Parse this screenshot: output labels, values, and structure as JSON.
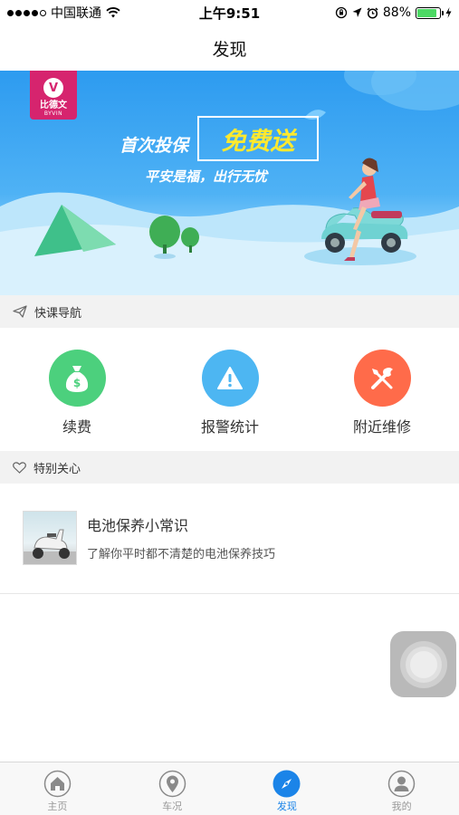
{
  "status_bar": {
    "carrier": "中国联通",
    "time": "上午9:51",
    "battery": "88%",
    "battery_level": 0.88
  },
  "nav": {
    "title": "发现"
  },
  "banner": {
    "brand": "比德文",
    "brand_sub": "BYVIN",
    "line1": "首次投保",
    "highlight": "免费送",
    "line2": "平安是福，出行无忧"
  },
  "quick_nav": {
    "title": "快课导航",
    "items": [
      {
        "label": "续费",
        "icon": "money-bag-icon",
        "color": "#4cd07d"
      },
      {
        "label": "报警统计",
        "icon": "warning-icon",
        "color": "#4db6f2"
      },
      {
        "label": "附近维修",
        "icon": "repair-tools-icon",
        "color": "#ff6b4a"
      }
    ]
  },
  "special_care": {
    "title": "特别关心",
    "articles": [
      {
        "title": "电池保养小常识",
        "desc": "了解你平时都不清楚的电池保养技巧"
      }
    ]
  },
  "tabs": [
    {
      "label": "主页",
      "icon": "home-icon",
      "active": false
    },
    {
      "label": "车况",
      "icon": "location-pin-icon",
      "active": false
    },
    {
      "label": "发现",
      "icon": "compass-icon",
      "active": true
    },
    {
      "label": "我的",
      "icon": "user-icon",
      "active": false
    }
  ],
  "colors": {
    "accent": "#1b84e8",
    "banner_sky": "#2d9bf0",
    "brand": "#d6246e"
  }
}
